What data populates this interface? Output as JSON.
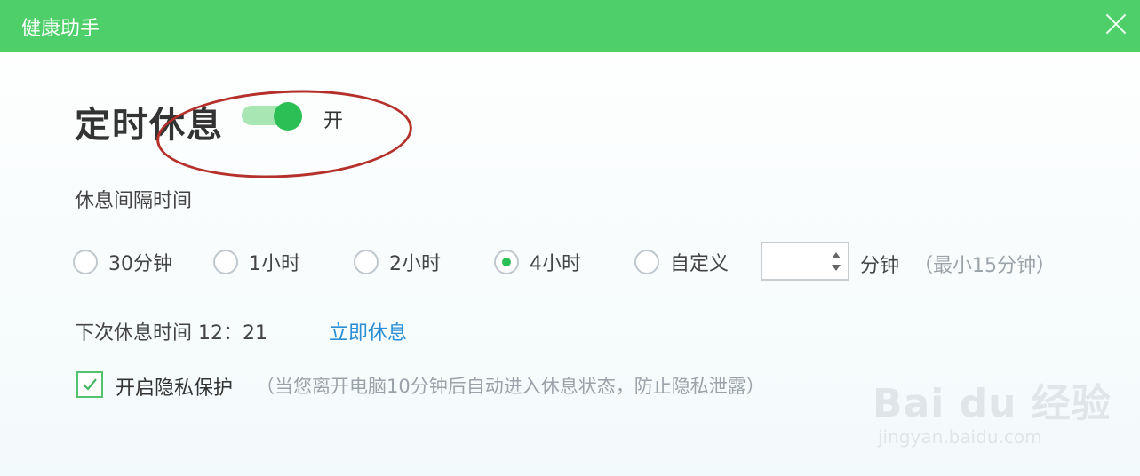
{
  "window": {
    "title": "健康助手"
  },
  "main": {
    "heading": "定时休息",
    "toggle": {
      "state": "开",
      "on": true
    },
    "interval_label": "休息间隔时间",
    "options": [
      {
        "label": "30分钟",
        "selected": false
      },
      {
        "label": "1小时",
        "selected": false
      },
      {
        "label": "2小时",
        "selected": false
      },
      {
        "label": "4小时",
        "selected": true
      },
      {
        "label": "自定义",
        "selected": false
      }
    ],
    "custom_value": "",
    "custom_unit": "分钟",
    "custom_hint": "（最小15分钟）",
    "next_break_label": "下次休息时间 12：21",
    "rest_now_link": "立即休息",
    "privacy": {
      "label": "开启隐私保护",
      "hint": "（当您离开电脑10分钟后自动进入休息状态，防止隐私泄露）",
      "checked": true
    }
  },
  "watermark": {
    "brand": "Bai du 经验",
    "url": "jingyan.baidu.com"
  },
  "colors": {
    "titlebar": "#4fcf6a",
    "accent": "#2bbf55",
    "link": "#2a8fd6",
    "annotation": "#b5302a"
  }
}
